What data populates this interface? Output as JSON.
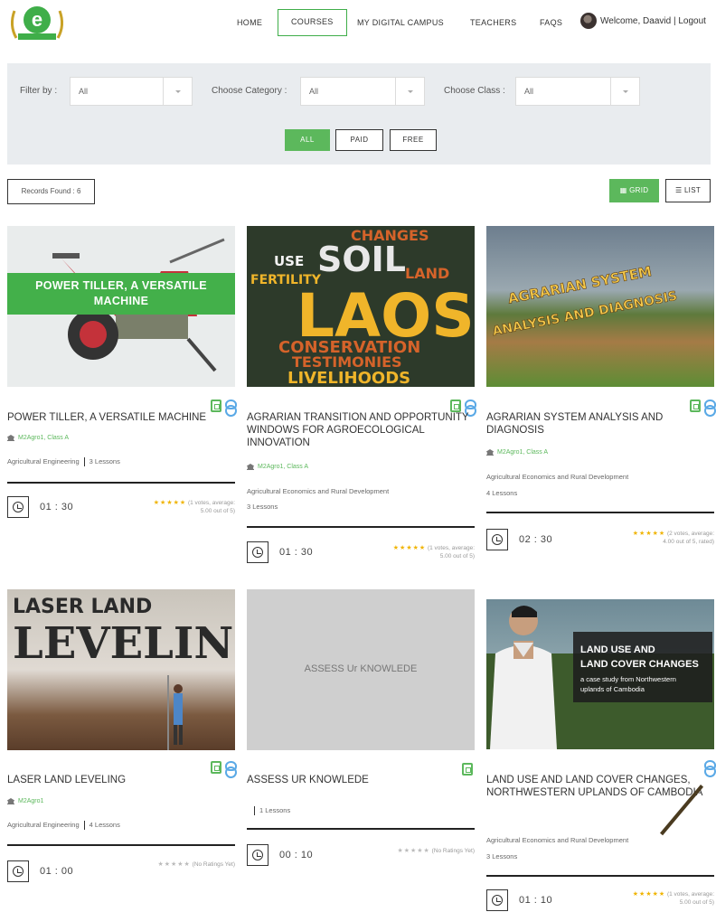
{
  "header": {
    "nav": [
      "HOME",
      "COURSES",
      "MY DIGITAL CAMPUS",
      "TEACHERS",
      "FAQS"
    ],
    "active_nav": "COURSES",
    "user_text": "Welcome, Daavid | Logout"
  },
  "filters": {
    "filter_by_label": "Filter by :",
    "filter_by_value": "All",
    "category_label": "Choose Category :",
    "category_value": "All",
    "class_label": "Choose Class :",
    "class_value": "All",
    "buttons": [
      "ALL",
      "PAID",
      "FREE"
    ]
  },
  "records": "Records Found : 6",
  "view": {
    "grid": "GRID",
    "list": "LIST"
  },
  "courses": [
    {
      "thumb_text": "POWER TILLER, A VERSATILE MACHINE",
      "title": "POWER TILLER, A VERSATILE MACHINE",
      "meta": "M2Agro1, Class A",
      "category": "Agricultural Engineering",
      "lessons": "3 Lessons",
      "duration": "01 : 30",
      "stars": "★★★★★",
      "rating_line1": "(1 votes, average:",
      "rating_line2": "5.00 out of 5)"
    },
    {
      "thumb_words": [
        "CHANGES",
        "USE",
        "SOIL",
        "LAND",
        "FERTILITY",
        "LAOS",
        "CONSERVATION",
        "TESTIMONIES",
        "LIVELIHOODS"
      ],
      "title": "AGRARIAN TRANSITION AND OPPORTUNITY WINDOWS FOR AGROECOLOGICAL INNOVATION",
      "meta": "M2Agro1, Class A",
      "category": "Agricultural Economics and Rural Development",
      "lessons": "3 Lessons",
      "duration": "01 : 30",
      "stars": "★★★★★",
      "rating_line1": "(1 votes, average:",
      "rating_line2": "5.00 out of 5)"
    },
    {
      "thumb_text_1": "AGRARIAN SYSTEM",
      "thumb_text_2": "ANALYSIS AND DIAGNOSIS",
      "title": "AGRARIAN SYSTEM ANALYSIS AND DIAGNOSIS",
      "meta": "M2Agro1, Class A",
      "category": "Agricultural Economics and Rural Development",
      "lessons": "4 Lessons",
      "duration": "02 : 30",
      "stars": "★★★★★",
      "rating_line1": "(2 votes, average:",
      "rating_line2": "4.00 out of 5, rated)"
    },
    {
      "thumb_text_1": "LASER LAND",
      "thumb_text_2": "LEVELING",
      "title": "LASER LAND LEVELING",
      "meta": "M2Agro1",
      "category": "Agricultural Engineering",
      "lessons": "4 Lessons",
      "duration": "01 : 00",
      "stars": "★★★★★",
      "rating_line1": "(No Ratings Yet)"
    },
    {
      "thumb_text": "ASSESS Ur KNOWLEDE",
      "title": "ASSESS Ur KNOWLEDE",
      "lessons": "1 Lessons",
      "duration": "00 : 10",
      "stars": "★★★★★",
      "rating_line1": "(No Ratings Yet)"
    },
    {
      "thumb_text_1": "LAND USE AND",
      "thumb_text_2": "LAND COVER CHANGES",
      "thumb_text_3": "a case study from Northwestern",
      "thumb_text_4": "uplands of Cambodia",
      "title": "LAND USE AND LAND COVER CHANGES, NORTHWESTERN UPLANDS OF CAMBODIA",
      "category": "Agricultural Economics and Rural Development",
      "lessons": "3 Lessons",
      "duration": "01 : 10",
      "stars": "★★★★★",
      "rating_line1": "(1 votes, average:",
      "rating_line2": "5.00 out of 5)"
    }
  ]
}
